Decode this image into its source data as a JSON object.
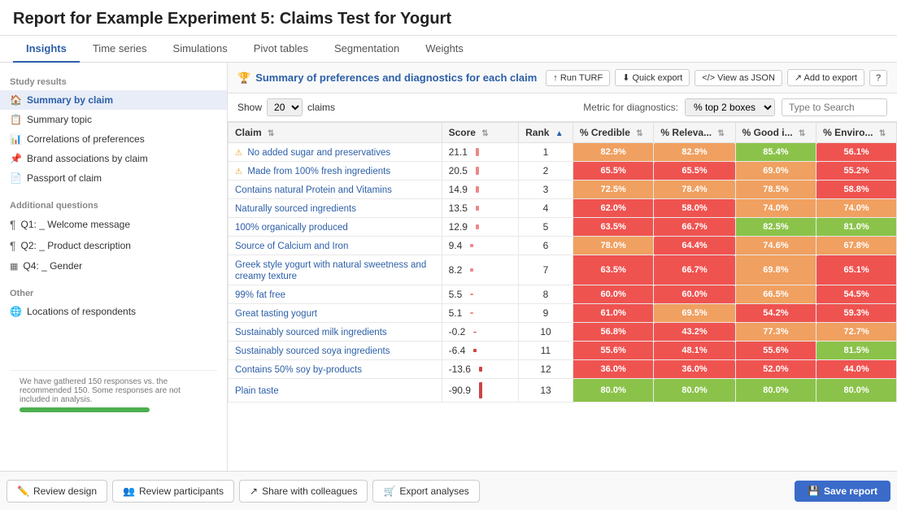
{
  "header": {
    "title": "Report for Example Experiment 5: Claims Test for Yogurt"
  },
  "tabs": [
    {
      "id": "insights",
      "label": "Insights",
      "active": true
    },
    {
      "id": "time-series",
      "label": "Time series",
      "active": false
    },
    {
      "id": "simulations",
      "label": "Simulations",
      "active": false
    },
    {
      "id": "pivot-tables",
      "label": "Pivot tables",
      "active": false
    },
    {
      "id": "segmentation",
      "label": "Segmentation",
      "active": false
    },
    {
      "id": "weights",
      "label": "Weights",
      "active": false
    }
  ],
  "sidebar": {
    "study_results_label": "Study results",
    "items": [
      {
        "id": "summary-by-claim",
        "label": "Summary by claim",
        "icon": "🏠",
        "active": true
      },
      {
        "id": "summary-by-topic",
        "label": "Summary topic",
        "icon": "📋",
        "active": false
      },
      {
        "id": "correlations",
        "label": "Correlations of preferences",
        "icon": "📊",
        "active": false
      },
      {
        "id": "brand-associations",
        "label": "Brand associations by claim",
        "icon": "📌",
        "active": false
      },
      {
        "id": "passport",
        "label": "Passport of claim",
        "icon": "📄",
        "active": false
      }
    ],
    "additional_questions_label": "Additional questions",
    "questions": [
      {
        "id": "q1",
        "label": "Q1: _ Welcome message",
        "icon": "¶"
      },
      {
        "id": "q2",
        "label": "Q2: _ Product description",
        "icon": "¶"
      },
      {
        "id": "q4",
        "label": "Q4: _ Gender",
        "icon": "▦"
      }
    ],
    "other_label": "Other",
    "other_items": [
      {
        "id": "locations",
        "label": "Locations of respondents",
        "icon": "🌐"
      }
    ],
    "bottom_text": "We have gathered 150 responses vs. the recommended 150. Some responses are not included in analysis."
  },
  "content": {
    "title": "Summary of preferences and diagnostics for each claim",
    "actions": {
      "run_turf": "↑ Run TURF",
      "quick_export": "⬇ Quick export",
      "view_json": "</> View as JSON",
      "add_to_export": "↗ Add to export",
      "help": "?"
    },
    "controls": {
      "show_label": "Show",
      "show_value": "20",
      "claims_label": "claims",
      "metric_label": "Metric for diagnostics:",
      "metric_value": "% top 2 boxes",
      "search_placeholder": "Type to Search"
    },
    "table": {
      "columns": [
        "Claim",
        "Score",
        "Rank",
        "% Credible",
        "% Releva...",
        "% Good i...",
        "% Enviro..."
      ],
      "rows": [
        {
          "claim": "No added sugar and preservatives",
          "score": "21.1",
          "rank": 1,
          "credible": "82.9%",
          "credible_color": "#f0a060",
          "relevance": "82.9%",
          "relevance_color": "#f0a060",
          "good": "85.4%",
          "good_color": "#8bc34a",
          "enviro": "56.1%",
          "enviro_color": "#ef5350",
          "has_icon": true
        },
        {
          "claim": "Made from 100% fresh ingredients",
          "score": "20.5",
          "rank": 2,
          "credible": "65.5%",
          "credible_color": "#ef5350",
          "relevance": "65.5%",
          "relevance_color": "#ef5350",
          "good": "69.0%",
          "good_color": "#f0a060",
          "enviro": "55.2%",
          "enviro_color": "#ef5350",
          "has_icon": true
        },
        {
          "claim": "Contains natural Protein and Vitamins",
          "score": "14.9",
          "rank": 3,
          "credible": "72.5%",
          "credible_color": "#f0a060",
          "relevance": "78.4%",
          "relevance_color": "#f0a060",
          "good": "78.5%",
          "good_color": "#f0a060",
          "enviro": "58.8%",
          "enviro_color": "#ef5350",
          "has_icon": false
        },
        {
          "claim": "Naturally sourced ingredients",
          "score": "13.5",
          "rank": 4,
          "credible": "62.0%",
          "credible_color": "#ef5350",
          "relevance": "58.0%",
          "relevance_color": "#ef5350",
          "good": "74.0%",
          "good_color": "#f0a060",
          "enviro": "74.0%",
          "enviro_color": "#f0a060",
          "has_icon": false
        },
        {
          "claim": "100% organically produced",
          "score": "12.9",
          "rank": 5,
          "credible": "63.5%",
          "credible_color": "#ef5350",
          "relevance": "66.7%",
          "relevance_color": "#ef5350",
          "good": "82.5%",
          "good_color": "#8bc34a",
          "enviro": "81.0%",
          "enviro_color": "#8bc34a",
          "has_icon": false
        },
        {
          "claim": "Source of Calcium and Iron",
          "score": "9.4",
          "rank": 6,
          "credible": "78.0%",
          "credible_color": "#f0a060",
          "relevance": "64.4%",
          "relevance_color": "#ef5350",
          "good": "74.6%",
          "good_color": "#f0a060",
          "enviro": "67.8%",
          "enviro_color": "#f0a060",
          "has_icon": false
        },
        {
          "claim": "Greek style yogurt with natural sweetness and creamy texture",
          "score": "8.2",
          "rank": 7,
          "credible": "63.5%",
          "credible_color": "#ef5350",
          "relevance": "66.7%",
          "relevance_color": "#ef5350",
          "good": "69.8%",
          "good_color": "#f0a060",
          "enviro": "65.1%",
          "enviro_color": "#ef5350",
          "has_icon": false
        },
        {
          "claim": "99% fat free",
          "score": "5.5",
          "rank": 8,
          "credible": "60.0%",
          "credible_color": "#ef5350",
          "relevance": "60.0%",
          "relevance_color": "#ef5350",
          "good": "66.5%",
          "good_color": "#f0a060",
          "enviro": "54.5%",
          "enviro_color": "#ef5350",
          "has_icon": false
        },
        {
          "claim": "Great tasting yogurt",
          "score": "5.1",
          "rank": 9,
          "credible": "61.0%",
          "credible_color": "#ef5350",
          "relevance": "69.5%",
          "relevance_color": "#f0a060",
          "good": "54.2%",
          "good_color": "#ef5350",
          "enviro": "59.3%",
          "enviro_color": "#ef5350",
          "has_icon": false
        },
        {
          "claim": "Sustainably sourced milk ingredients",
          "score": "-0.2",
          "rank": 10,
          "credible": "56.8%",
          "credible_color": "#ef5350",
          "relevance": "43.2%",
          "relevance_color": "#ef5350",
          "good": "77.3%",
          "good_color": "#f0a060",
          "enviro": "72.7%",
          "enviro_color": "#f0a060",
          "has_icon": false
        },
        {
          "claim": "Sustainably sourced soya ingredients",
          "score": "-6.4",
          "rank": 11,
          "credible": "55.6%",
          "credible_color": "#ef5350",
          "relevance": "48.1%",
          "relevance_color": "#ef5350",
          "good": "55.6%",
          "good_color": "#ef5350",
          "enviro": "81.5%",
          "enviro_color": "#8bc34a",
          "has_icon": false
        },
        {
          "claim": "Contains 50% soy by-products",
          "score": "-13.6",
          "rank": 12,
          "credible": "36.0%",
          "credible_color": "#ef5350",
          "relevance": "36.0%",
          "relevance_color": "#ef5350",
          "good": "52.0%",
          "good_color": "#ef5350",
          "enviro": "44.0%",
          "enviro_color": "#ef5350",
          "has_icon": false
        },
        {
          "claim": "Plain taste",
          "score": "-90.9",
          "rank": 13,
          "credible": "80.0%",
          "credible_color": "#8bc34a",
          "relevance": "80.0%",
          "relevance_color": "#8bc34a",
          "good": "80.0%",
          "good_color": "#8bc34a",
          "enviro": "80.0%",
          "enviro_color": "#8bc34a",
          "has_icon": false
        }
      ]
    }
  },
  "footer": {
    "review_design": "Review design",
    "review_participants": "Review participants",
    "share_colleagues": "Share with colleagues",
    "export_analyses": "Export analyses",
    "save_report": "Save report"
  }
}
